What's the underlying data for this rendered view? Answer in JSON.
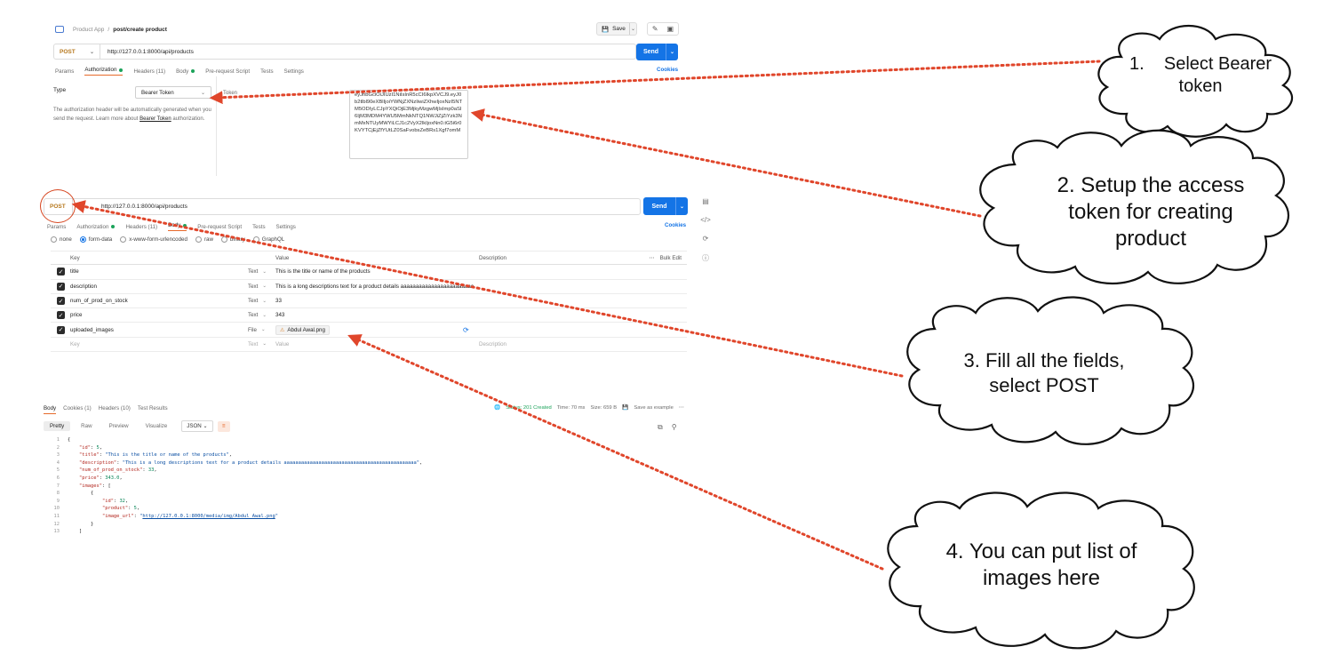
{
  "request1": {
    "breadcrumb_app": "Product App",
    "breadcrumb_sep": "/",
    "breadcrumb_current": "post/create product",
    "save_label": "Save",
    "method": "POST",
    "url": "http://127.0.0.1:8000/api/products",
    "send_label": "Send",
    "tabs": [
      "Params",
      "Authorization",
      "Headers (11)",
      "Body",
      "Pre-request Script",
      "Tests",
      "Settings"
    ],
    "cookies_label": "Cookies",
    "auth": {
      "type_label": "Type",
      "type_value": "Bearer Token",
      "description": "The authorization header will be automatically generated when you send the request. Learn more about",
      "link_text": "Bearer Token",
      "description_end": "authorization.",
      "token_label": "Token",
      "token_value": "eyJhbGciOiJIUzI1NiIsInR5cCI6IkpXVCJ9.eyJ0b2tlbl90eXBlIjoiYWNjZXNzIiwiZXhwIjoxNzI5NTM5ODIyLCJpYXQiOjE3MjkyMzgwMjIsImp0aSI6IjM3MDM4YWU5MmNkNTQ1NWJiZjZiYzk3NmMxNTUyMWYiLCJ1c2VyX2lkIjoxNn0.tG5i6r0KVYTCjEjZfYUtLZ0SaFvobsZeBRs1Xgf7omM"
    }
  },
  "request2": {
    "method": "POST",
    "url": "http://127.0.0.1:8000/api/products",
    "send_label": "Send",
    "tabs": [
      "Params",
      "Authorization",
      "Headers (11)",
      "Body",
      "Pre-request Script",
      "Tests",
      "Settings"
    ],
    "cookies_label": "Cookies",
    "body_modes": [
      "none",
      "form-data",
      "x-www-form-urlencoded",
      "raw",
      "binary",
      "GraphQL"
    ],
    "table_headers": {
      "key": "Key",
      "value": "Value",
      "description": "Description",
      "bulk_edit": "Bulk Edit"
    },
    "rows": [
      {
        "key": "title",
        "type": "Text",
        "value": "This is the title or name of the products"
      },
      {
        "key": "description",
        "type": "Text",
        "value": "This is a long descriptions text for a product details aaaaaaaaaaaaaaaaaaaaaaaa"
      },
      {
        "key": "num_of_prod_on_stock",
        "type": "Text",
        "value": "33"
      },
      {
        "key": "price",
        "type": "Text",
        "value": "343"
      },
      {
        "key": "uploaded_images",
        "type": "File",
        "value": "Abdul Awal.png"
      }
    ],
    "placeholder_row": {
      "key": "Key",
      "type": "Text",
      "value": "Value",
      "description": "Description"
    }
  },
  "response": {
    "tabs": [
      "Body",
      "Cookies (1)",
      "Headers (10)",
      "Test Results"
    ],
    "status": "Status: 201 Created",
    "time": "Time: 70 ms",
    "size": "Size: 659 B",
    "save_example": "Save as example",
    "view_tabs": [
      "Pretty",
      "Raw",
      "Preview",
      "Visualize"
    ],
    "format": "JSON",
    "json": {
      "id": 5,
      "title": "This is the title or name of the products",
      "description": "This is a long descriptions text for a product details aaaaaaaaaaaaaaaaaaaaaaaaaaaaaaaaaaaaaaaaaaaaaa",
      "num_of_prod_on_stock": 33,
      "price": "343.0",
      "image_id": 32,
      "image_product": 5,
      "image_url": "http://127.0.0.1:8000/media/img/Abdul_Awal.png"
    }
  },
  "callouts": [
    {
      "number": "1.",
      "text": "Select Bearer token"
    },
    {
      "number": "2.",
      "text": "Setup the  access token for creating product"
    },
    {
      "number": "3.",
      "text": "Fill all the fields, select POST"
    },
    {
      "number": "4.",
      "text": "You can put list of images here"
    }
  ],
  "colors": {
    "accent": "#1474e6",
    "arrow": "#e0462b",
    "method": "#b7791f"
  }
}
